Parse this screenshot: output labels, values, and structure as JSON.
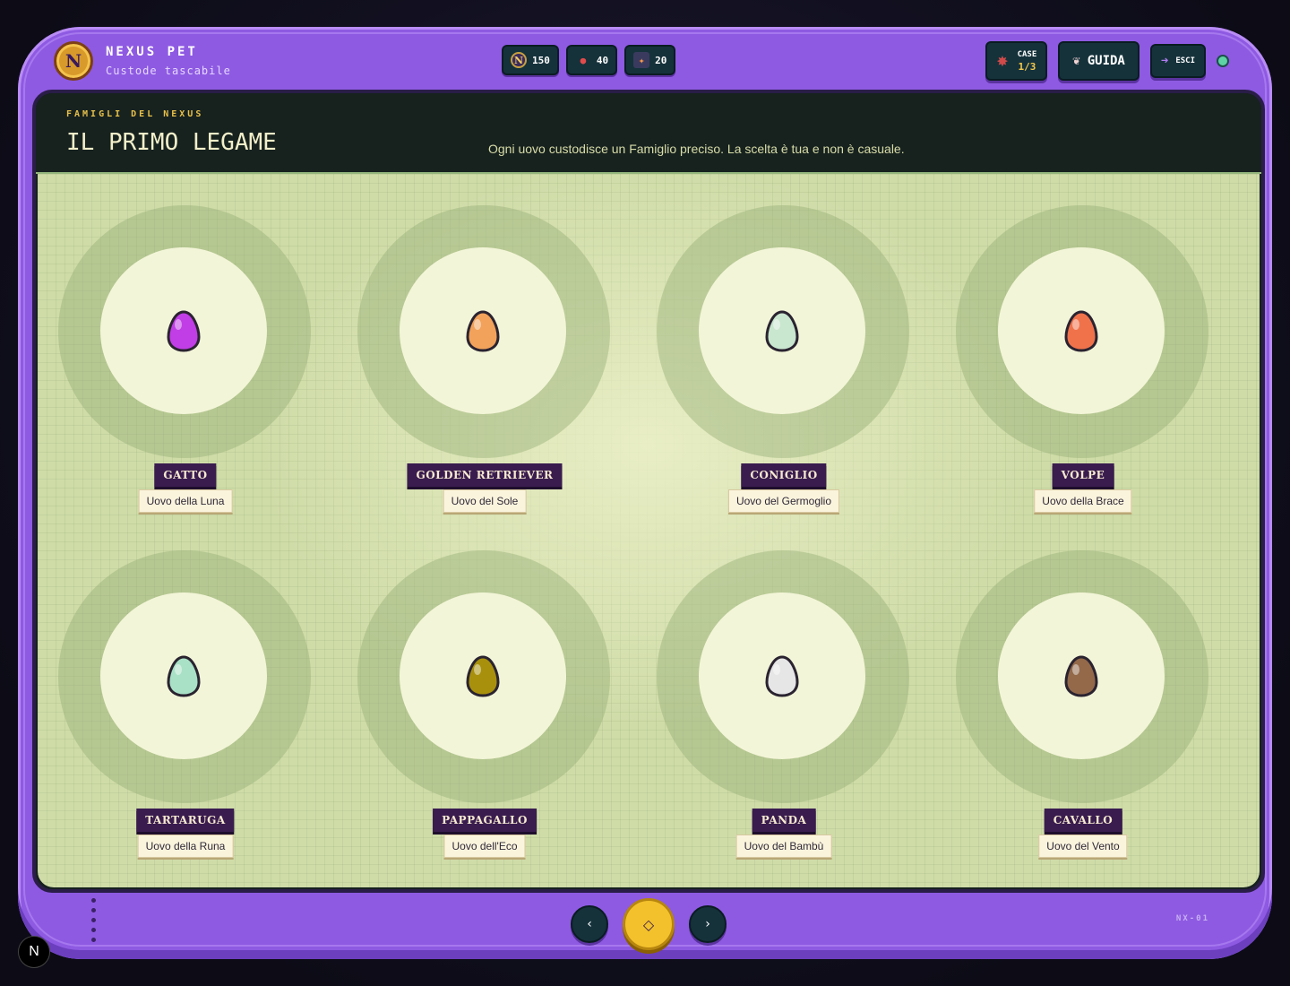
{
  "brand": {
    "title": "NEXUS PET",
    "subtitle": "Custode tascabile",
    "logo_icon": "nexus-coin-logo"
  },
  "stats": [
    {
      "icon": "nexus-coin-icon",
      "value": "150"
    },
    {
      "icon": "potion-bag-icon",
      "value": "40"
    },
    {
      "icon": "loot-box-icon",
      "value": "20"
    }
  ],
  "case": {
    "label": "CASE",
    "value": "1/3"
  },
  "guide": {
    "label": "GUIDA"
  },
  "exit": {
    "label": "ESCI"
  },
  "screen": {
    "eyebrow": "FAMIGLI DEL NEXUS",
    "title": "IL PRIMO LEGAME",
    "subtitle": "Ogni uovo custodisce un Famiglio preciso. La scelta è tua e non è casuale."
  },
  "eggs": [
    {
      "name": "GATTO",
      "desc": "Uovo della Luna",
      "color": "#c13ee6"
    },
    {
      "name": "GOLDEN RETRIEVER",
      "desc": "Uovo del Sole",
      "color": "#f2a25a"
    },
    {
      "name": "CONIGLIO",
      "desc": "Uovo del Germoglio",
      "color": "#c9e6cf"
    },
    {
      "name": "VOLPE",
      "desc": "Uovo della Brace",
      "color": "#f0724b"
    },
    {
      "name": "TARTARUGA",
      "desc": "Uovo della Runa",
      "color": "#a9e1c6"
    },
    {
      "name": "PAPPAGALLO",
      "desc": "Uovo dell'Eco",
      "color": "#a8900c"
    },
    {
      "name": "PANDA",
      "desc": "Uovo del Bambù",
      "color": "#e6e6e6"
    },
    {
      "name": "CAVALLO",
      "desc": "Uovo del Vento",
      "color": "#93694a"
    }
  ],
  "footer": {
    "prev_icon": "‹",
    "center_icon": "◇",
    "next_icon": "›",
    "serial": "NX-01"
  },
  "corner_badge": "N"
}
